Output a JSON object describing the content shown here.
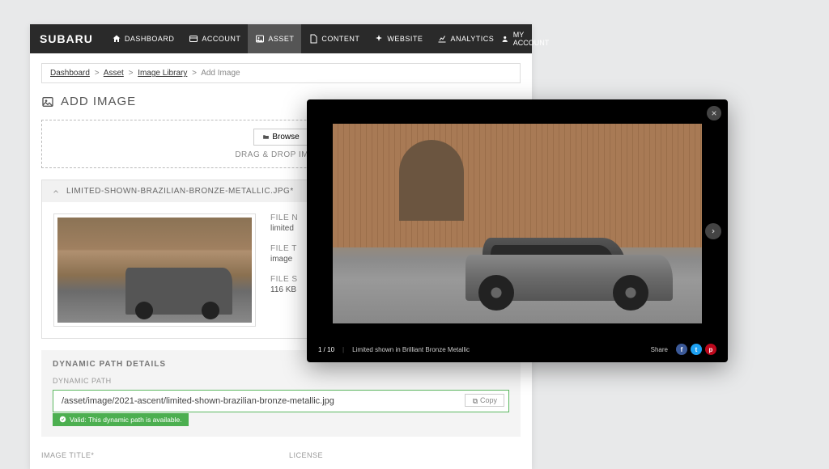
{
  "brand": "SUBARU",
  "nav": [
    {
      "label": "DASHBOARD"
    },
    {
      "label": "ACCOUNT"
    },
    {
      "label": "ASSET"
    },
    {
      "label": "CONTENT"
    },
    {
      "label": "WEBSITE"
    },
    {
      "label": "ANALYTICS"
    }
  ],
  "account_label": "MY ACCOUNT",
  "breadcrumb": {
    "items": [
      "Dashboard",
      "Asset",
      "Image Library"
    ],
    "current": "Add Image",
    "sep": ">"
  },
  "page_title": "ADD IMAGE",
  "dropzone": {
    "browse": "Browse",
    "hint": "DRAG & DROP IMAGE"
  },
  "accordion": {
    "title": "LIMITED-SHOWN-BRAZILIAN-BRONZE-METALLIC.JPG*",
    "meta": {
      "l0": "FILE N",
      "v0": "limited",
      "l1": "FILE T",
      "v1": "image",
      "l2": "FILE S",
      "v2": "116 KB"
    }
  },
  "dynamic": {
    "panel_title": "DYNAMIC PATH DETAILS",
    "label": "DYNAMIC PATH",
    "value": "/asset/image/2021-ascent/limited-shown-brazilian-bronze-metallic.jpg",
    "copy": "Copy",
    "valid": "Valid: This dynamic path is available."
  },
  "form": {
    "col1": "IMAGE TITLE*",
    "col2": "LICENSE"
  },
  "lightbox": {
    "counter": "1 / 10",
    "caption": "Limited shown in Brilliant Bronze Metallic",
    "share": "Share",
    "socials": {
      "fb": "f",
      "tw": "t",
      "pn": "p"
    }
  }
}
